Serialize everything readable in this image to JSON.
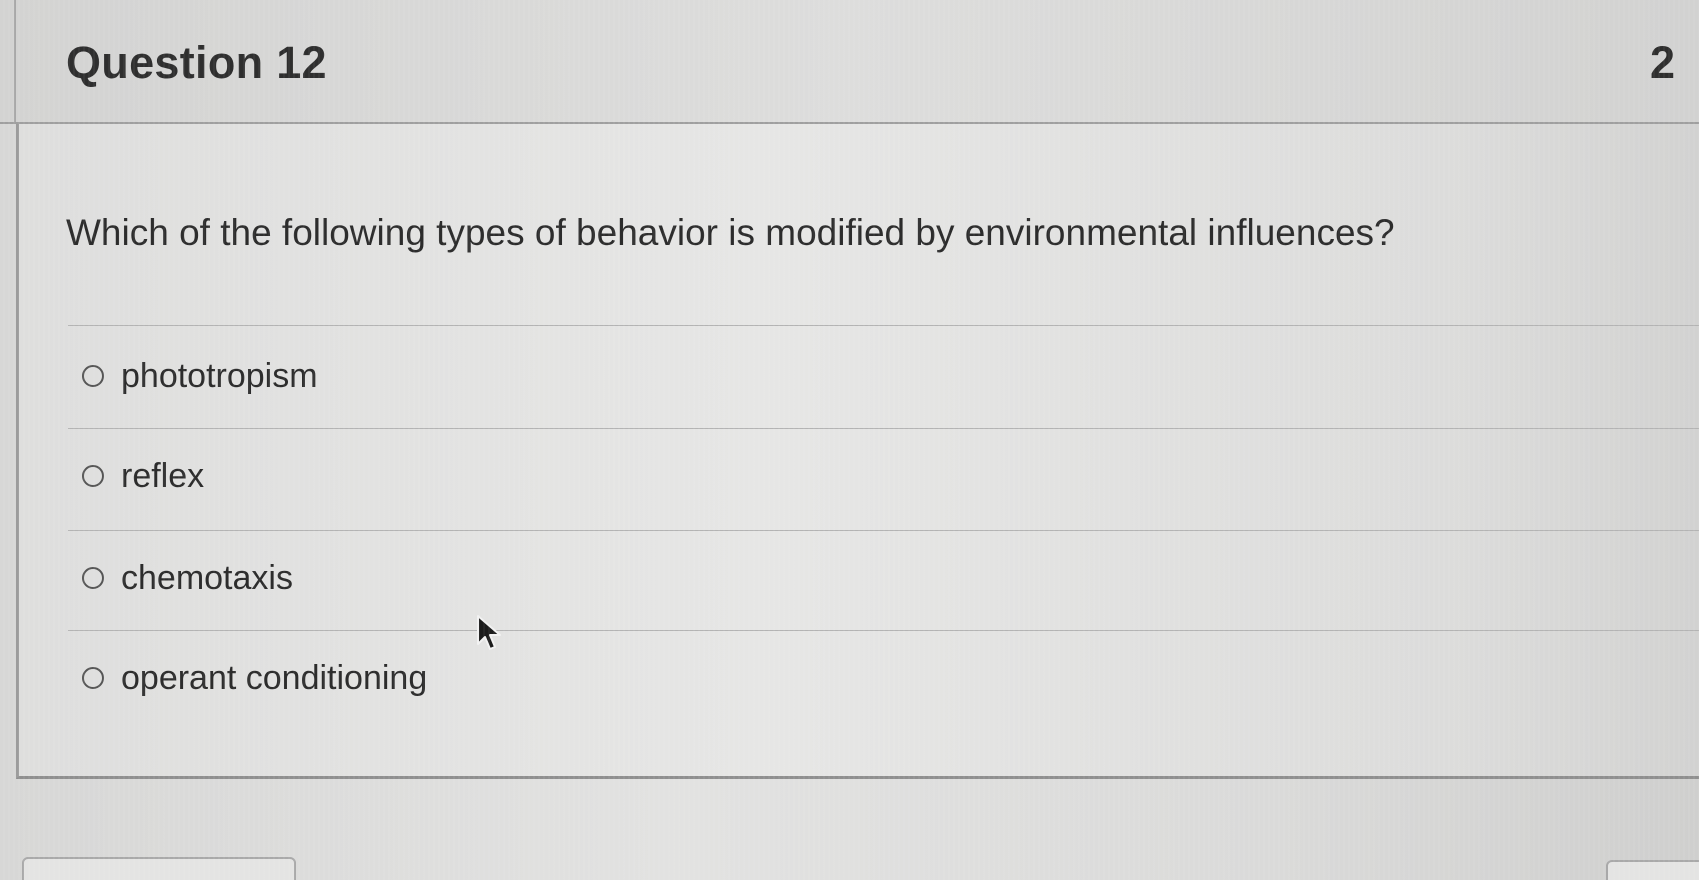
{
  "question": {
    "title": "Question 12",
    "points": "2",
    "prompt": "Which of the following types of behavior is modified by environmental influences?",
    "answers": [
      {
        "label": "phototropism",
        "selected": false
      },
      {
        "label": "reflex",
        "selected": false
      },
      {
        "label": "chemotaxis",
        "selected": false
      },
      {
        "label": "operant conditioning",
        "selected": false
      }
    ]
  },
  "icons": {
    "radio": "radio-unselected-icon",
    "cursor": "mouse-pointer-icon"
  },
  "colors": {
    "background": "#dcdcdb",
    "text": "#2c2c2c",
    "divider": "#b3b3b3"
  }
}
